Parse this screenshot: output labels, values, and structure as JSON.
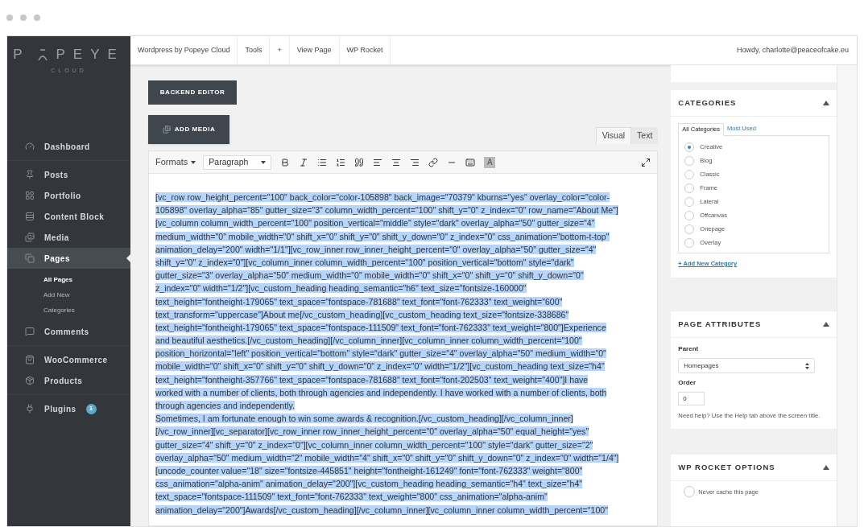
{
  "logo": {
    "left": "P",
    "right": "PEYE",
    "sub": "CLOUD"
  },
  "sidebar": {
    "groups": [
      [
        {
          "label": "Dashboard",
          "selected": false
        }
      ],
      [
        {
          "label": "Posts",
          "selected": false
        },
        {
          "label": "Portfolio",
          "selected": false
        },
        {
          "label": "Content Block",
          "selected": false
        },
        {
          "label": "Media",
          "selected": false
        },
        {
          "label": "Pages",
          "selected": true,
          "children": [
            {
              "label": "All Pages",
              "selected": true
            },
            {
              "label": "Add New",
              "selected": false
            },
            {
              "label": "Categories",
              "selected": false
            }
          ]
        },
        {
          "label": "Comments",
          "selected": false
        }
      ],
      [
        {
          "label": "WooCommerce",
          "selected": false
        },
        {
          "label": "Products",
          "selected": false
        }
      ],
      [
        {
          "label": "Plugins",
          "selected": false,
          "badge": "1"
        }
      ]
    ]
  },
  "topbar": {
    "items": [
      "Wordpress by Popeye Cloud",
      "Tools",
      "+",
      "View Page",
      "WP Rocket"
    ],
    "user": "Howdy, charlotte@peaceofcake.eu"
  },
  "editor": {
    "buttons": [
      "BACKEND EDITOR",
      "ADD MEDIA"
    ],
    "tabs": [
      {
        "label": "Visual",
        "selected": true
      },
      {
        "label": "Text",
        "selected": false
      }
    ],
    "formats": "Formats",
    "paragraph": "Paragraph",
    "text_color": "A",
    "selected": true,
    "lines": [
      "[vc_row row_height_percent=\"100\" back_color=\"color-105898\" back_image=\"70379\" kburns=\"yes\" overlay_color=\"color-",
      "105898\" overlay_alpha=\"85\" gutter_size=\"3\" column_width_percent=\"100\" shift_y=\"0\" z_index=\"0\" row_name=\"About Me\"]",
      "[vc_column column_width_percent=\"100\" position_vertical=\"middle\" style=\"dark\" overlay_alpha=\"50\" gutter_size=\"4\"",
      "medium_width=\"0\" mobile_width=\"0\" shift_x=\"0\" shift_y=\"0\" shift_y_down=\"0\" z_index=\"0\" css_animation=\"bottom-t-top\"",
      "animation_delay=\"200\" width=\"1/1\"][vc_row_inner row_inner_height_percent=\"0\" overlay_alpha=\"50\" gutter_size=\"4\"",
      "shift_y=\"0\" z_index=\"0\"][vc_column_inner column_width_percent=\"100\" position_vertical=\"bottom\" style=\"dark\"",
      "gutter_size=\"3\" overlay_alpha=\"50\" medium_width=\"0\" mobile_width=\"0\" shift_x=\"0\" shift_y=\"0\" shift_y_down=\"0\"",
      "z_index=\"0\" width=\"1/2\"][vc_custom_heading heading_semantic=\"h6\" text_size=\"fontsize-160000\"",
      "text_height=\"fontheight-179065\" text_space=\"fontspace-781688\" text_font=\"font-762333\" text_weight=\"600\"",
      "text_transform=\"uppercase\"]About me[/vc_custom_heading][vc_custom_heading text_size=\"fontsize-338686\"",
      "text_height=\"fontheight-179065\" text_space=\"fontspace-111509\" text_font=\"font-762333\" text_weight=\"800\"]Experience",
      "and beautiful aesthetics.[/vc_custom_heading][/vc_column_inner][vc_column_inner column_width_percent=\"100\"",
      "position_horizontal=\"left\" position_vertical=\"bottom\" style=\"dark\" gutter_size=\"4\" overlay_alpha=\"50\" medium_width=\"0\"",
      "mobile_width=\"0\" shift_x=\"0\" shift_y=\"0\" shift_y_down=\"0\" z_index=\"0\" width=\"1/2\"][vc_custom_heading text_size=\"h4\"",
      "text_height=\"fontheight-357766\" text_space=\"fontspace-781688\" text_font=\"font-202503\" text_weight=\"400\"]I have",
      "worked with a number of clients, both through agencies and independently. I have worked with a number of clients, both",
      "through agencies and independently.",
      "Sometimes, I am fortunate enough to win some awards & recognition.[/vc_custom_heading][/vc_column_inner]",
      "[/vc_row_inner][vc_separator][vc_row_inner row_inner_height_percent=\"0\" overlay_alpha=\"50\" equal_height=\"yes\"",
      "gutter_size=\"4\" shift_y=\"0\" z_index=\"0\"][vc_column_inner column_width_percent=\"100\" style=\"dark\" gutter_size=\"2\"",
      "overlay_alpha=\"50\" medium_width=\"2\" mobile_width=\"4\" shift_x=\"0\" shift_y=\"0\" shift_y_down=\"0\" z_index=\"0\" width=\"1/4\"]",
      "[uncode_counter value=\"18\" size=\"fontsize-445851\" height=\"fontheight-161249\" font=\"font-762333\" weight=\"800\"",
      "css_animation=\"alpha-anim\" animation_delay=\"200\"][vc_custom_heading heading_semantic=\"h4\" text_size=\"h4\"",
      "text_space=\"fontspace-111509\" text_font=\"font-762333\" text_weight=\"800\" css_animation=\"alpha-anim\"",
      "animation_delay=\"200\"]Awards[/vc_custom_heading][/vc_column_inner][vc_column_inner column_width_percent=\"100\""
    ]
  },
  "categories": {
    "title": "CATEGORIES",
    "tabs": [
      {
        "label": "All Categories",
        "selected": true
      },
      {
        "label": "Most Used",
        "selected": false
      }
    ],
    "items": [
      {
        "label": "Creative",
        "selected": true
      },
      {
        "label": "Blog",
        "selected": false
      },
      {
        "label": "Classic",
        "selected": false
      },
      {
        "label": "Frame",
        "selected": false
      },
      {
        "label": "Lateral",
        "selected": false
      },
      {
        "label": "Offcanvas",
        "selected": false
      },
      {
        "label": "Onepage",
        "selected": false
      },
      {
        "label": "Overlay",
        "selected": false
      }
    ],
    "add_link": "+ Add New Category"
  },
  "page_attributes": {
    "title": "PAGE ATTRIBUTES",
    "parent_label": "Parent",
    "parent_value": "Homepages",
    "order_label": "Order",
    "order_value": "0",
    "help": "Need help? Use the Help tab above the screen title."
  },
  "wp_rocket": {
    "title": "WP ROCKET OPTIONS",
    "option": {
      "label": "Never cache this page",
      "checked": false
    }
  }
}
